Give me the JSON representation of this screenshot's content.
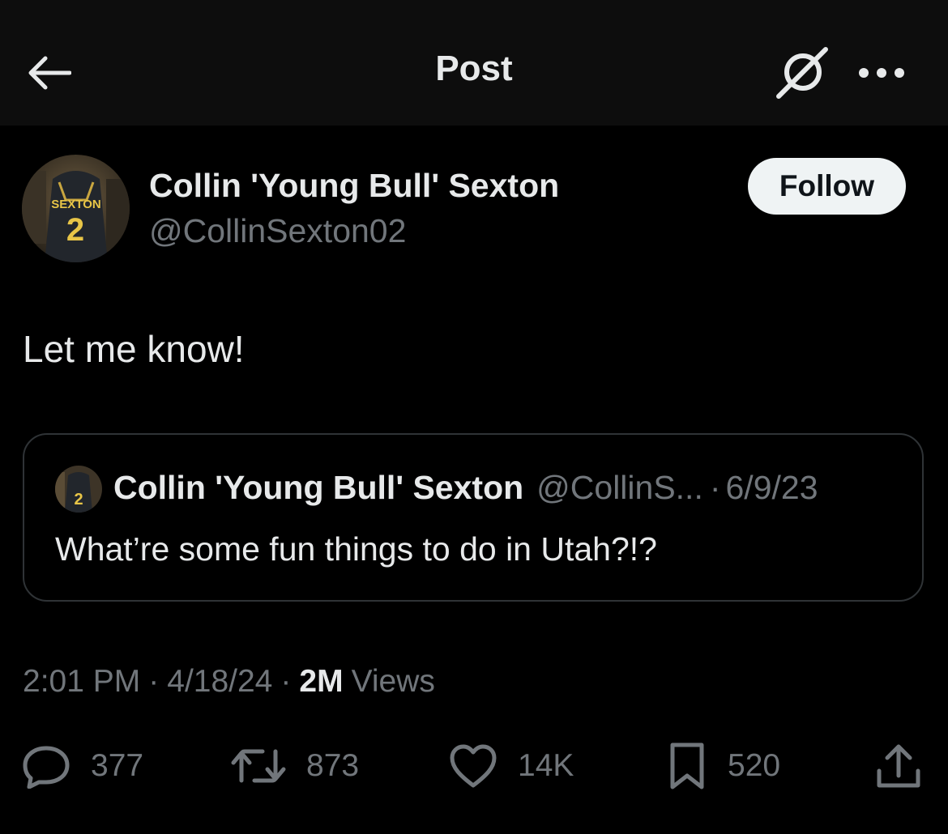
{
  "header": {
    "title": "Post"
  },
  "author": {
    "name": "Collin 'Young Bull' Sexton",
    "handle": "@CollinSexton02",
    "follow_label": "Follow",
    "jersey_name": "SEXTON",
    "jersey_number": "2"
  },
  "post": {
    "text": "Let me know!",
    "time": "2:01 PM",
    "date": "4/18/24",
    "views_count": "2M",
    "views_label": "Views"
  },
  "quote": {
    "name": "Collin 'Young Bull' Sexton",
    "handle_truncated": "@CollinS...",
    "date": "6/9/23",
    "text": "What’re some fun things to do in Utah?!?",
    "jersey_number": "2"
  },
  "actions": {
    "replies": "377",
    "reposts": "873",
    "likes": "14K",
    "bookmarks": "520"
  },
  "icons": {
    "back": "back-arrow-icon",
    "grok": "grok-icon",
    "more": "more-icon",
    "reply": "reply-icon",
    "repost": "repost-icon",
    "like": "heart-icon",
    "bookmark": "bookmark-icon",
    "share": "share-icon"
  },
  "colors": {
    "background": "#000000",
    "header_background": "#0d0d0d",
    "primary_text": "#e7e9ea",
    "secondary_text": "#71767b",
    "border": "#2f3336",
    "follow_button_bg": "#eff3f4",
    "jersey_number": "#e8c547"
  }
}
